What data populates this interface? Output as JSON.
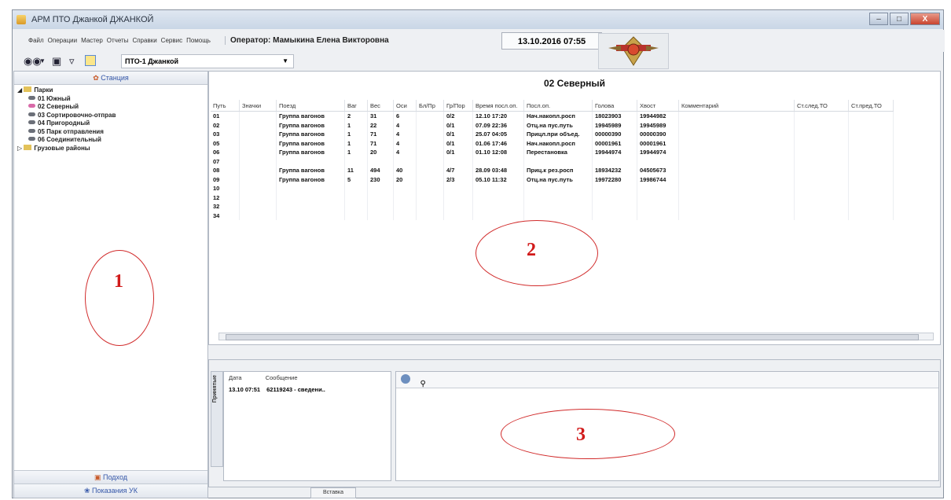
{
  "window": {
    "title": "АРМ ПТО Джанкой ДЖАНКОЙ",
    "controls": [
      "–",
      "□",
      "X"
    ]
  },
  "menu": [
    "Файл",
    "Операции",
    "Мастер",
    "Отчеты",
    "Справки",
    "Сервис",
    "Помощь"
  ],
  "operator": "Оператор: Мамыкина Елена Викторовна",
  "datetime": "13.10.2016 07:55",
  "toolbar": {
    "select_value": "ПТО-1 Джанкой"
  },
  "left_panel": {
    "header": "Станция",
    "tree": {
      "root": "Парки",
      "items": [
        "01 Южный",
        "02 Северный",
        "03 Сортировочно-отправ",
        "04 Пригородный",
        "05 Парк отправления",
        "06 Соединительный"
      ],
      "selected": "02 Северный",
      "other": "Грузовые районы"
    },
    "footer1": "Подход",
    "footer2": "Показания УК"
  },
  "main": {
    "title": "02 Северный",
    "columns": [
      "Путь",
      "Значки",
      "Поезд",
      "Ваг",
      "Вес",
      "Оси",
      "Бл/Пр",
      "Гр/Пор",
      "Время посл.оп.",
      "Посл.оп.",
      "Голова",
      "Хвост",
      "Комментарий",
      "Ст.след.ТО",
      "Ст.пред.ТО"
    ],
    "rows": [
      [
        "01",
        "",
        "Группа вагонов",
        "2",
        "31",
        "6",
        "",
        "0/2",
        "12.10 17:20",
        "Нач.накопл.росп",
        "18023903",
        "19944982",
        "",
        "",
        ""
      ],
      [
        "02",
        "",
        "Группа вагонов",
        "1",
        "22",
        "4",
        "",
        "0/1",
        "07.09 22:36",
        "Отц.на пус.путь",
        "19945989",
        "19945989",
        "",
        "",
        ""
      ],
      [
        "03",
        "",
        "Группа вагонов",
        "1",
        "71",
        "4",
        "",
        "0/1",
        "25.07 04:05",
        "Прицл.при объед.",
        "00000390",
        "00000390",
        "",
        "",
        ""
      ],
      [
        "05",
        "",
        "Группа вагонов",
        "1",
        "71",
        "4",
        "",
        "0/1",
        "01.06 17:46",
        "Нач.накопл.росп",
        "00001961",
        "00001961",
        "",
        "",
        ""
      ],
      [
        "06",
        "",
        "Группа вагонов",
        "1",
        "20",
        "4",
        "",
        "0/1",
        "01.10 12:08",
        "Перестановка",
        "19944974",
        "19944974",
        "",
        "",
        ""
      ],
      [
        "07",
        "",
        "",
        "",
        "",
        "",
        "",
        "",
        "",
        "",
        "",
        "",
        "",
        "",
        ""
      ],
      [
        "08",
        "",
        "Группа вагонов",
        "11",
        "494",
        "40",
        "",
        "4/7",
        "28.09 03:48",
        "Приц.к рез.росп",
        "18934232",
        "04505673",
        "",
        "",
        ""
      ],
      [
        "09",
        "",
        "Группа вагонов",
        "5",
        "230",
        "20",
        "",
        "2/3",
        "05.10 11:32",
        "Отц.на пус.путь",
        "19972280",
        "19986744",
        "",
        "",
        ""
      ],
      [
        "10",
        "",
        "",
        "",
        "",
        "",
        "",
        "",
        "",
        "",
        "",
        "",
        "",
        "",
        ""
      ],
      [
        "12",
        "",
        "",
        "",
        "",
        "",
        "",
        "",
        "",
        "",
        "",
        "",
        "",
        "",
        ""
      ],
      [
        "32",
        "",
        "",
        "",
        "",
        "",
        "",
        "",
        "",
        "",
        "",
        "",
        "",
        "",
        ""
      ],
      [
        "34",
        "",
        "",
        "",
        "",
        "",
        "",
        "",
        "",
        "",
        "",
        "",
        "",
        "",
        ""
      ]
    ]
  },
  "messages": {
    "vertical_tab": "Принятые",
    "columns": [
      "Дата",
      "Сообщение"
    ],
    "rows": [
      [
        "13.10 07:51",
        "62119243 - сведени.."
      ]
    ]
  },
  "bottom_tab": "Вставка",
  "annotations": [
    "1",
    "2",
    "3"
  ]
}
